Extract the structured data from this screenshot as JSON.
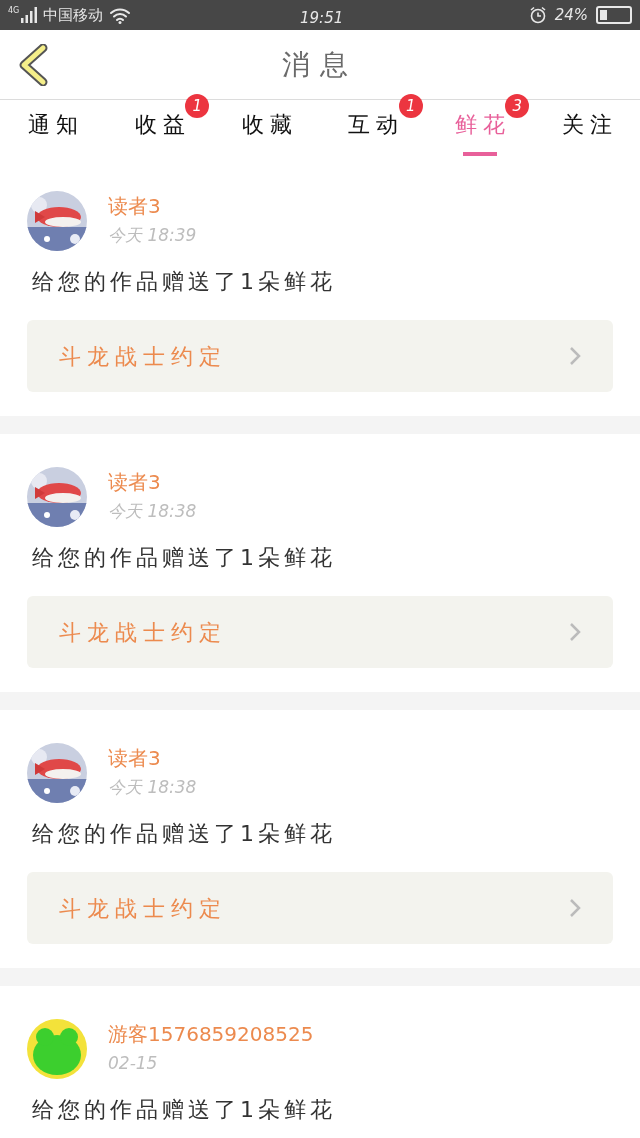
{
  "status_bar": {
    "network": "4G",
    "carrier": "中国移动",
    "time": "19:51",
    "battery_text": "24%"
  },
  "header": {
    "title": "消息"
  },
  "tabs": [
    {
      "label": "通知",
      "selected": false
    },
    {
      "label": "收益",
      "selected": false,
      "badge": "1"
    },
    {
      "label": "收藏",
      "selected": false
    },
    {
      "label": "互动",
      "selected": false,
      "badge": "1"
    },
    {
      "label": "鲜花",
      "selected": true,
      "badge": "3"
    },
    {
      "label": "关注",
      "selected": false
    }
  ],
  "messages": [
    {
      "name": "读者3",
      "time": "今天 18:39",
      "text": "给您的作品赠送了1朵鲜花",
      "book": "斗龙战士约定"
    },
    {
      "name": "读者3",
      "time": "今天 18:38",
      "text": "给您的作品赠送了1朵鲜花",
      "book": "斗龙战士约定"
    },
    {
      "name": "读者3",
      "time": "今天 18:38",
      "text": "给您的作品赠送了1朵鲜花",
      "book": "斗龙战士约定"
    },
    {
      "avatar": {
        "kind": "cartoon"
      },
      "name": "游客1576859208525",
      "time": "02-15",
      "text": "给您的作品赠送了1朵鲜花"
    }
  ]
}
